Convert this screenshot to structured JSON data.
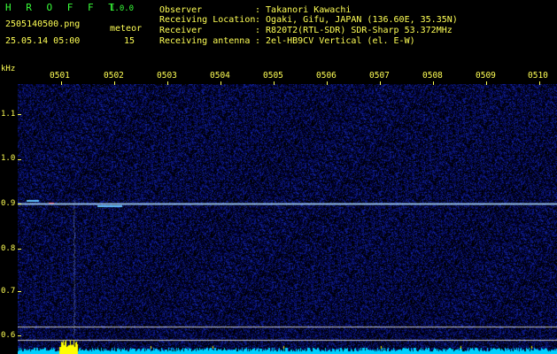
{
  "header": {
    "title": "H R O F F T",
    "version": "1.0.0",
    "filename": "2505140500.png",
    "meteor_label": "meteor",
    "datetime": "25.05.14 05:00",
    "meteor_count": "15",
    "observer_label": "Observer",
    "observer_value": ": Takanori Kawachi",
    "location_label": "Receiving Location",
    "location_value": ": Ogaki, Gifu, JAPAN (136.60E, 35.35N)",
    "receiver_label": "Receiver",
    "receiver_value": ": R820T2(RTL-SDR) SDR-Sharp 53.372MHz",
    "antenna_label": "Receiving antenna",
    "antenna_value": ": 2el-HB9CV Vertical (el. E-W)"
  },
  "axis": {
    "y_unit": "kHz",
    "y_ticks": [
      "1.1",
      "1.0",
      "0.9",
      "0.8",
      "0.7",
      "0.6"
    ],
    "x_ticks": [
      "0501",
      "0502",
      "0503",
      "0504",
      "0505",
      "0506",
      "0507",
      "0508",
      "0509",
      "0510"
    ]
  },
  "colors": {
    "background": "#000000",
    "header_green": "#39ff39",
    "label_yellow": "#ffff55",
    "noise_blue": "#1a2a8a",
    "signal_line": "#a8d8ff",
    "meteor_yellow": "#ffff00",
    "bottom_trace": "#00d0ff"
  }
}
